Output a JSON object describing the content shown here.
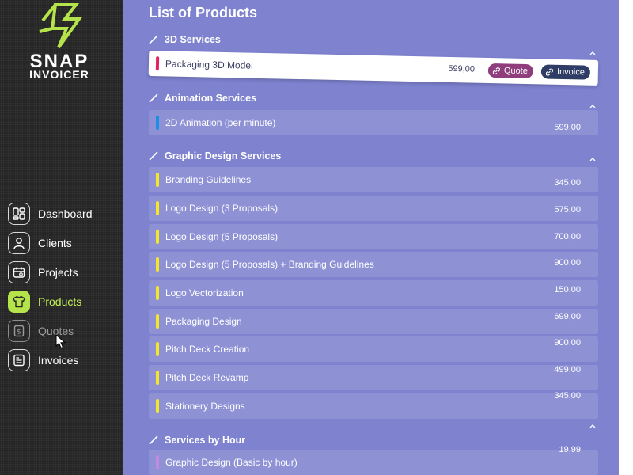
{
  "brand": {
    "line1": "SNAP",
    "line2": "INVOICER",
    "accent": "#b5e34a"
  },
  "sidebar": {
    "items": [
      {
        "label": "Dashboard",
        "icon": "dashboard-icon"
      },
      {
        "label": "Clients",
        "icon": "user-icon"
      },
      {
        "label": "Projects",
        "icon": "projects-icon"
      },
      {
        "label": "Products",
        "icon": "tshirt-icon",
        "active": true
      },
      {
        "label": "Quotes",
        "icon": "dollar-doc-icon"
      },
      {
        "label": "Invoices",
        "icon": "invoice-icon"
      }
    ]
  },
  "main": {
    "title": "List of Products",
    "sections": [
      {
        "name": "3D Services",
        "color": "#e0245e",
        "items": [
          {
            "name": "Packaging 3D Model",
            "price": "599,00",
            "actions": [
              "Quote",
              "Invoice"
            ]
          }
        ]
      },
      {
        "name": "Animation Services",
        "color": "#1a8fe3",
        "items": [
          {
            "name": "2D Animation (per minute)",
            "price": "599,00"
          }
        ]
      },
      {
        "name": "Graphic Design Services",
        "color": "#f5e62a",
        "items": [
          {
            "name": "Branding Guidelines",
            "price": "345,00"
          },
          {
            "name": "Logo Design (3 Proposals)",
            "price": "575,00"
          },
          {
            "name": "Logo Design (5 Proposals)",
            "price": "700,00"
          },
          {
            "name": "Logo Design (5 Proposals) + Branding Guidelines",
            "price": "900,00"
          },
          {
            "name": "Logo Vectorization",
            "price": "150,00"
          },
          {
            "name": "Packaging Design",
            "price": "699,00"
          },
          {
            "name": "Pitch Deck Creation",
            "price": "900,00"
          },
          {
            "name": "Pitch Deck Revamp",
            "price": "499,00"
          },
          {
            "name": "Stationery Designs",
            "price": "345,00"
          }
        ]
      },
      {
        "name": "Services by Hour",
        "color": "#c08ae0",
        "items": [
          {
            "name": "Graphic Design (Basic by hour)",
            "price": "19,99"
          }
        ]
      }
    ]
  }
}
